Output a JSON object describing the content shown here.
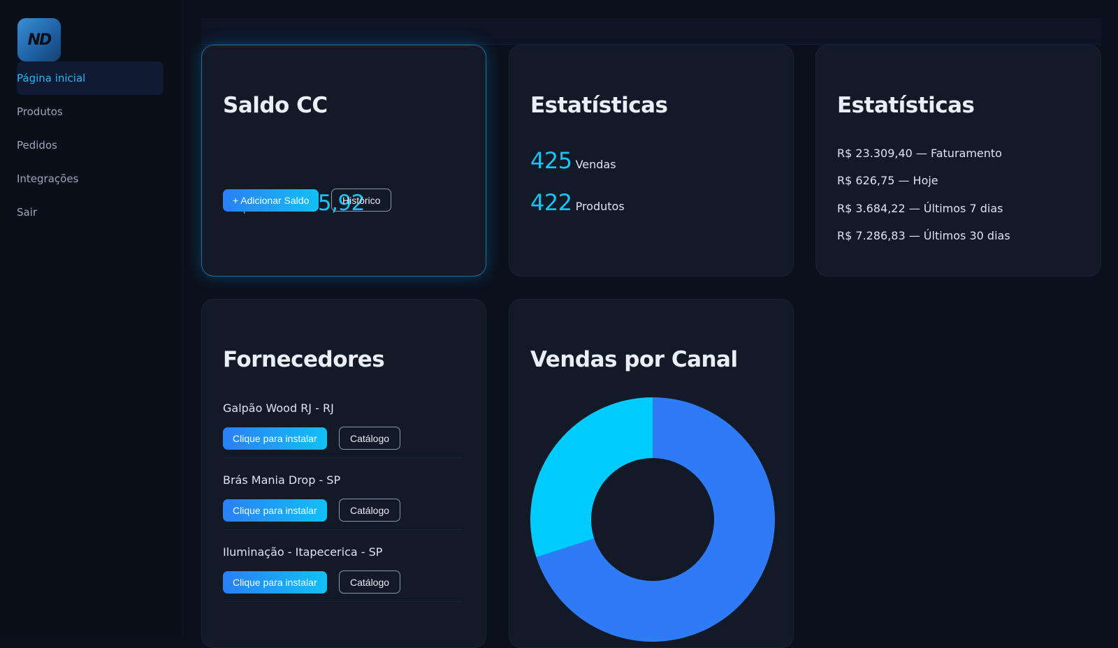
{
  "brand": {
    "logo_text": "ND"
  },
  "sidebar": {
    "items": [
      {
        "label": "Página inicial",
        "active": true
      },
      {
        "label": "Produtos"
      },
      {
        "label": "Pedidos"
      },
      {
        "label": "Integrações"
      },
      {
        "label": "Sair"
      }
    ]
  },
  "balance_card": {
    "title": "Saldo CC",
    "amount": "R$ 22.785,92",
    "add_button": "+ Adicionar Saldo",
    "history_button": "Histórico"
  },
  "stats_card": {
    "title": "Estatísticas",
    "sales_value": "425",
    "sales_label": "Vendas",
    "products_value": "422",
    "products_label": "Produtos"
  },
  "revenue_card": {
    "title": "Estatísticas",
    "lines": [
      "R$ 23.309,40 — Faturamento",
      "R$ 626,75 — Hoje",
      "R$ 3.684,22 — Últimos 7 dias",
      "R$ 7.286,83 — Últimos 30 dias"
    ]
  },
  "suppliers_card": {
    "title": "Fornecedores",
    "suppliers": [
      {
        "name": "Galpão Wood RJ - RJ",
        "install_button": "Clique para instalar",
        "catalog_button": "Catálogo"
      },
      {
        "name": "Brás Mania Drop - SP",
        "install_button": "Clique para instalar",
        "catalog_button": "Catálogo"
      },
      {
        "name": "Iluminação - Itapecerica - SP",
        "install_button": "Clique para instalar",
        "catalog_button": "Catálogo"
      }
    ]
  },
  "channel_card": {
    "title": "Vendas por Canal"
  },
  "colors": {
    "accent": "#18c3f6",
    "primary_blue": "#2f7bf7",
    "cyan": "#00cbff",
    "background": "#0b111c",
    "card": "#121a27"
  },
  "chart_data": {
    "type": "pie",
    "title": "Vendas por Canal",
    "donut": true,
    "slices": [
      {
        "value": 70,
        "color": "#2f7bf7"
      },
      {
        "value": 30,
        "color": "#00cbff"
      }
    ]
  }
}
